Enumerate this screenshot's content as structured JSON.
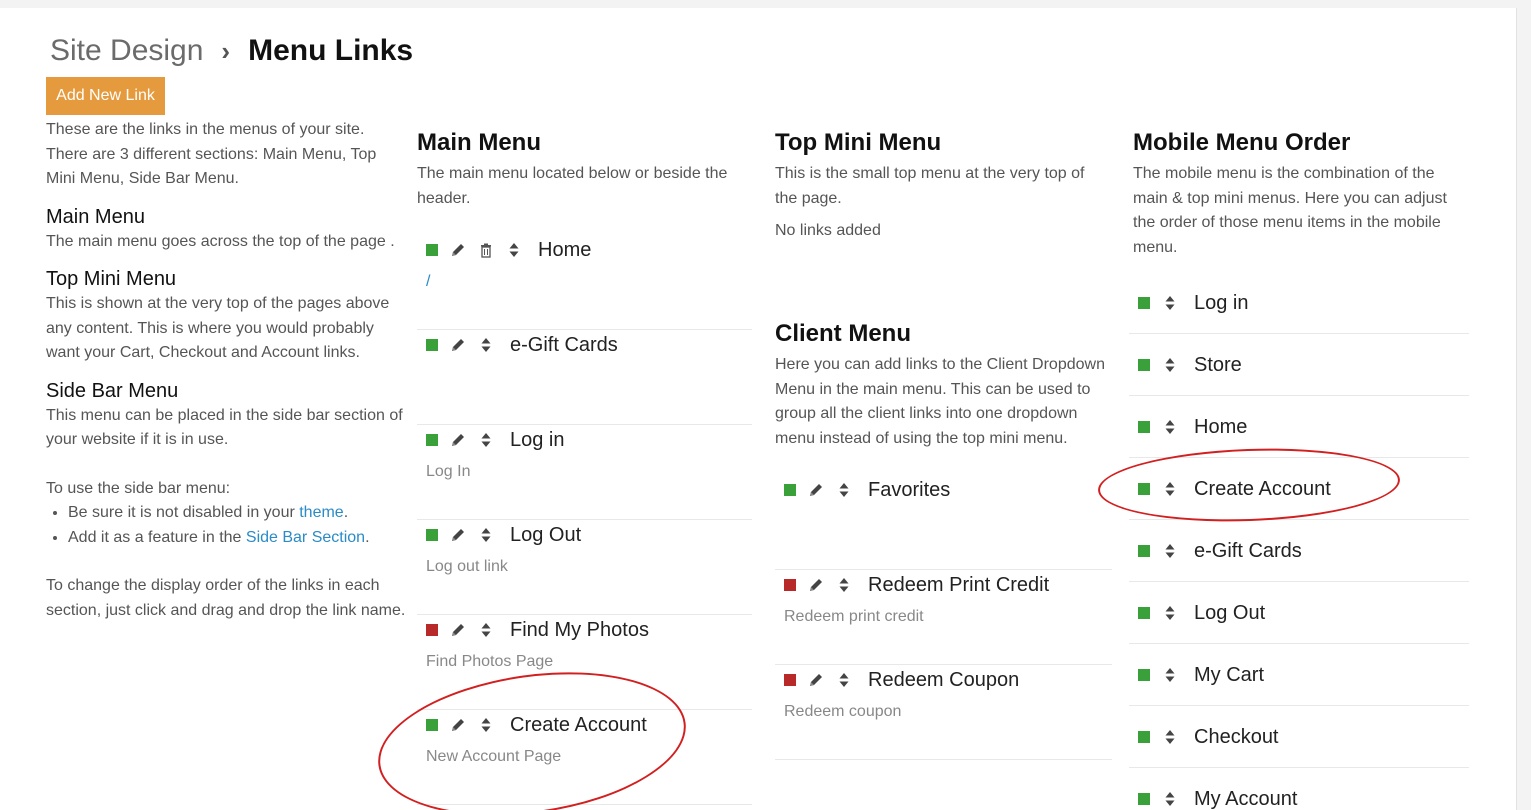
{
  "breadcrumb": {
    "parent": "Site Design",
    "separator": "›",
    "current": "Menu Links"
  },
  "add_button": "Add New Link",
  "left": {
    "intro": "These are the links in the menus of your site. There are 3 different sections: Main Menu, Top Mini Menu, Side Bar Menu.",
    "main_title": "Main Menu",
    "main_desc": "The main menu goes across the top of the page .",
    "topmini_title": "Top Mini Menu",
    "topmini_desc": "This is shown at the very top of the pages above any content. This is where you would probably want your Cart, Checkout and Account links.",
    "sidebar_title": "Side Bar Menu",
    "sidebar_desc": "This menu can be placed in the side bar section of your website if it is in use.",
    "sidebar_use": "To use the side bar menu:",
    "bullet1_pre": "Be sure it is not disabled in your ",
    "bullet1_link": "theme",
    "bullet1_post": ".",
    "bullet2_pre": "Add it as a feature in the ",
    "bullet2_link": "Side Bar Section",
    "bullet2_post": ".",
    "order_note": "To change the display order of the links in each section, just click and drag and drop the link name."
  },
  "main_menu": {
    "title": "Main Menu",
    "desc": "The main menu located below or beside the header.",
    "items": [
      {
        "label": "Home",
        "sub": "/",
        "status": "green"
      },
      {
        "label": "e-Gift Cards",
        "sub": "",
        "status": "green"
      },
      {
        "label": "Log in",
        "sub": "Log In",
        "status": "green"
      },
      {
        "label": "Log Out",
        "sub": "Log out link",
        "status": "green"
      },
      {
        "label": "Find My Photos",
        "sub": "Find Photos Page",
        "status": "red"
      },
      {
        "label": "Create Account",
        "sub": "New Account Page",
        "status": "green"
      }
    ]
  },
  "top_mini": {
    "title": "Top Mini Menu",
    "desc": "This is the small top menu at the very top of the page.",
    "empty": "No links added"
  },
  "client_menu": {
    "title": "Client Menu",
    "desc": "Here you can add links to the Client Dropdown Menu in the main menu. This can be used to group all the client links into one dropdown menu instead of using the top mini menu.",
    "items": [
      {
        "label": "Favorites",
        "sub": "",
        "status": "green"
      },
      {
        "label": "Redeem Print Credit",
        "sub": "Redeem print credit",
        "status": "red"
      },
      {
        "label": "Redeem Coupon",
        "sub": "Redeem coupon",
        "status": "red"
      }
    ]
  },
  "mobile": {
    "title": "Mobile Menu Order",
    "desc": "The mobile menu is the combination of the main & top mini menus. Here you can adjust the order of those menu items in the mobile menu.",
    "items": [
      "Log in",
      "Store",
      "Home",
      "Create Account",
      "e-Gift Cards",
      "Log Out",
      "My Cart",
      "Checkout",
      "My Account"
    ]
  },
  "colors": {
    "green": "#3aa03a",
    "red": "#b82a2a",
    "accent": "#e59a3d",
    "link": "#2a8bc7"
  },
  "icons": {
    "edit": "pencil-icon",
    "delete": "trash-icon",
    "sort": "sort-arrows-icon"
  }
}
